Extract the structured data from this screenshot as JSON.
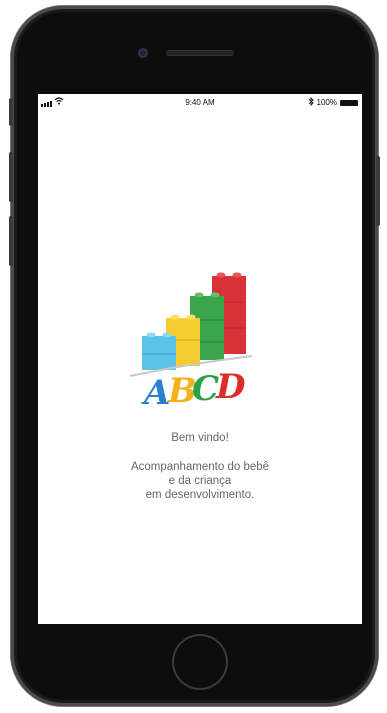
{
  "status_bar": {
    "time": "9:40 AM",
    "battery_percent": "100%",
    "icons": [
      "signal-icon",
      "wifi-icon",
      "bluetooth-icon",
      "battery-icon"
    ]
  },
  "logo": {
    "text": "ABCD",
    "letter_colors": [
      "#2a7fd0",
      "#f2b21c",
      "#2ea04a",
      "#e02b2b"
    ],
    "block_colors": [
      "#5bc3e8",
      "#f6cd2e",
      "#3aa64c",
      "#d9333a"
    ]
  },
  "welcome": {
    "title": "Bem vindo!",
    "description_lines": [
      "Acompanhamento do bebê",
      "e da criança",
      "em desenvolvimento."
    ]
  }
}
